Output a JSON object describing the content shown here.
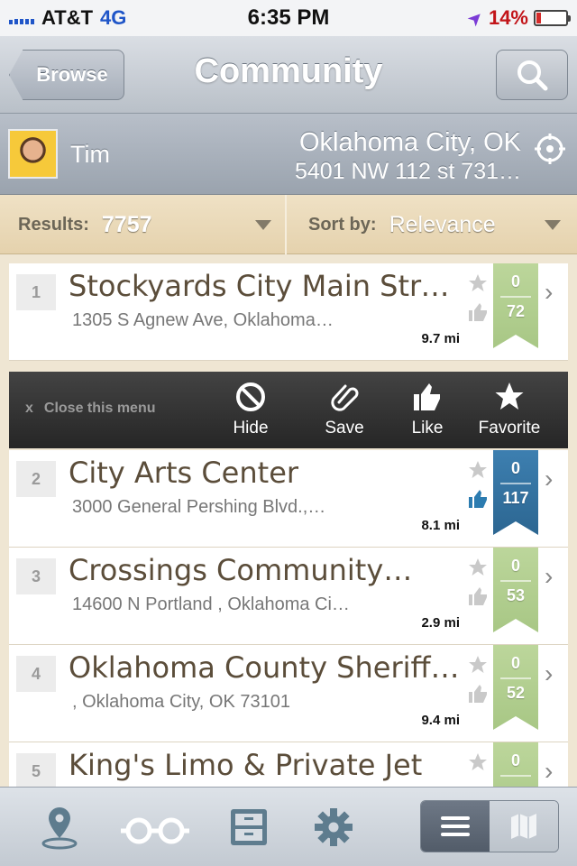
{
  "status_bar": {
    "carrier": "AT&T",
    "network": "4G",
    "time": "6:35 PM",
    "battery_percent": "14%",
    "battery_level": 0.14
  },
  "nav": {
    "back_label": "Browse",
    "title": "Community"
  },
  "user": {
    "name": "Tim",
    "location_city": "Oklahoma City, OK",
    "location_address": "5401 NW 112 st 731…"
  },
  "filters": {
    "results_label": "Results:",
    "results_count": "7757",
    "sort_label": "Sort by:",
    "sort_value": "Relevance"
  },
  "action_menu": {
    "close_x": "x",
    "close_label": "Close this menu",
    "hide_label": "Hide",
    "save_label": "Save",
    "like_label": "Like",
    "favorite_label": "Favorite"
  },
  "rows": [
    {
      "num": "1",
      "title": "Stockyards City Main Street",
      "address": "1305 S Agnew Ave, Oklahoma…",
      "distance": "9.7 mi",
      "favorites": "0",
      "likes": "72",
      "ribbon_color": "green"
    },
    {
      "num": "2",
      "title": "City Arts Center",
      "address": "3000 General Pershing Blvd.,…",
      "distance": "8.1 mi",
      "favorites": "0",
      "likes": "117",
      "ribbon_color": "blue"
    },
    {
      "num": "3",
      "title": "Crossings Community…",
      "address": "14600 N Portland , Oklahoma Ci…",
      "distance": "2.9 mi",
      "favorites": "0",
      "likes": "53",
      "ribbon_color": "green"
    },
    {
      "num": "4",
      "title": "Oklahoma County Sheriff…",
      "address": ", Oklahoma City, OK 73101",
      "distance": "9.4 mi",
      "favorites": "0",
      "likes": "52",
      "ribbon_color": "green"
    },
    {
      "num": "5",
      "title": "King's Limo & Private Jet",
      "address": "",
      "distance": "",
      "favorites": "0",
      "likes": "",
      "ribbon_color": "green"
    }
  ],
  "icons": {
    "tab_1": "map-pin-icon",
    "tab_2": "glasses-icon",
    "tab_3": "cabinet-icon",
    "tab_4": "gear-icon",
    "seg_list": "list-icon",
    "seg_map": "map-icon"
  },
  "colors": {
    "ribbon_green": "#a8c785",
    "ribbon_blue": "#2c6691",
    "title_brown": "#5b4d3a"
  }
}
